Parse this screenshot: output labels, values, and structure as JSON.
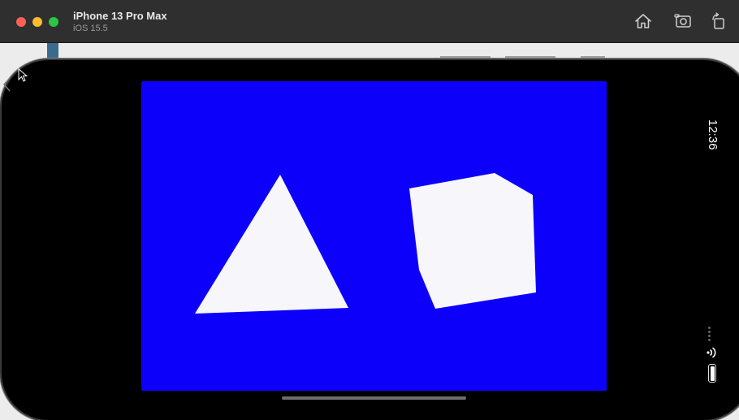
{
  "window": {
    "device_name": "iPhone 13 Pro Max",
    "os_version": "iOS 15.5"
  },
  "toolbar": {
    "buttons": [
      {
        "name": "home-icon"
      },
      {
        "name": "screenshot-icon"
      },
      {
        "name": "rotate-icon"
      }
    ]
  },
  "status_bar": {
    "time": "12:36"
  },
  "scene": {
    "background_color": "#0d00fa",
    "shape_color": "#f7f7fb",
    "shapes": [
      "triangle",
      "cube"
    ]
  }
}
